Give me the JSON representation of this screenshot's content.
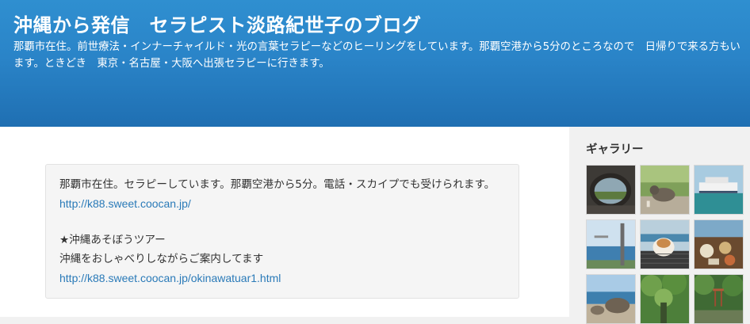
{
  "header": {
    "title": "沖縄から発信　セラピスト淡路紀世子のブログ",
    "description": "那覇市在住。前世療法・インナーチャイルド・光の言葉セラピーなどのヒーリングをしています。那覇空港から5分のところなので　日帰りで来る方もいます。ときどき　東京・名古屋・大阪へ出張セラピーに行きます。"
  },
  "main": {
    "intro_text": "那覇市在住。セラピーしています。那覇空港から5分。電話・スカイプでも受けられます。",
    "intro_link": "http://k88.sweet.coocan.jp/",
    "tour_title": "★沖縄あそぼうツアー",
    "tour_text": "沖縄をおしゃべりしながらご案内してます",
    "tour_link": "http://k88.sweet.coocan.jp/okinawatuar1.html"
  },
  "sidebar": {
    "gallery_title": "ギャラリー"
  }
}
